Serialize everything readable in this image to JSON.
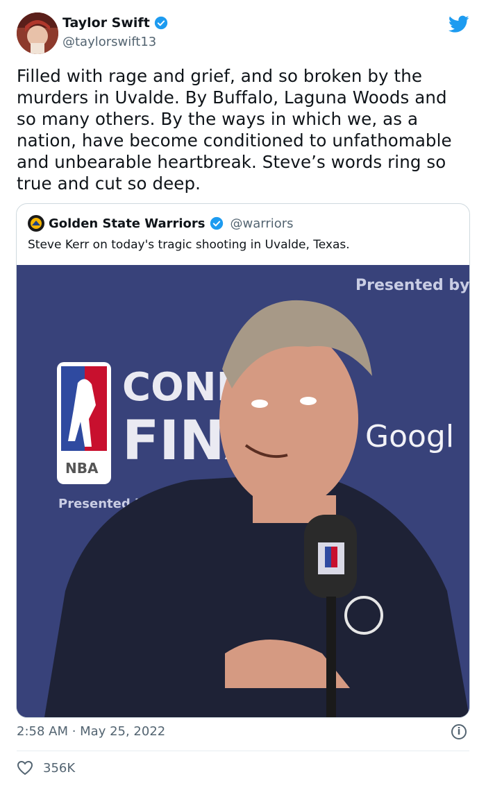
{
  "author": {
    "name": "Taylor Swift",
    "handle": "@taylorswift13",
    "verified": true
  },
  "tweet_text": "Filled with rage and grief, and so broken by the\nmurders in Uvalde. By Buffalo, Laguna Woods and\nso many others. By the ways in which we, as a\nnation, have become conditioned to unfathomable\nand unbearable heartbreak. Steve’s words ring so\ntrue and cut so deep.",
  "quoted": {
    "name": "Golden State Warriors",
    "handle": "@warriors",
    "verified": true,
    "text": "Steve Kerr on today's tragic shooting in Uvalde, Texas.",
    "media": {
      "backdrop_texts": [
        "Presented by Goog",
        "CONFER",
        "FINA",
        "Googl",
        "NBA",
        "Presented by"
      ]
    }
  },
  "timestamp": "2:58 AM · May 25, 2022",
  "likes": "356K",
  "colors": {
    "twitter_blue": "#1d9bf0",
    "muted": "#536471",
    "backdrop": "#38427a"
  },
  "icons": [
    "twitter-bird-icon",
    "verified-badge-icon",
    "info-icon",
    "heart-icon"
  ]
}
